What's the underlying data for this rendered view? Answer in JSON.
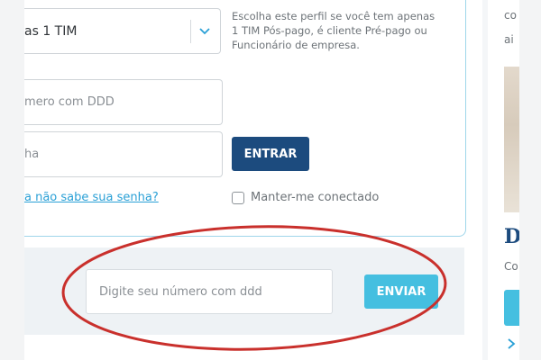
{
  "login": {
    "profile_select": {
      "value": "as 1 TIM"
    },
    "profile_help": "Escolha este perfil se você tem apenas 1 TIM Pós-pago, é cliente Pré-pago ou Funcionário de empresa.",
    "phone_field": {
      "placeholder": "mero com DDD"
    },
    "password_field": {
      "placeholder": "ha"
    },
    "submit_label": "ENTRAR",
    "forgot_link": "a não sabe sua senha?",
    "keep_connected_label": "Manter-me conectado"
  },
  "sms_form": {
    "input_placeholder": "Digite seu número com ddd",
    "submit_label": "ENVIAR"
  },
  "side": {
    "text_top_1": "co",
    "text_top_2": "ai",
    "heading": "D",
    "text_mid": "Co"
  },
  "colors": {
    "primary_button": "#1c4b7e",
    "accent_button": "#45bfe0",
    "link": "#2aa0d6",
    "card_border": "#9fd6ea",
    "annotation_ellipse": "#c9302c"
  },
  "icons": {
    "select_chevron": "chevron-down-icon",
    "side_chevron": "chevron-right-icon"
  }
}
